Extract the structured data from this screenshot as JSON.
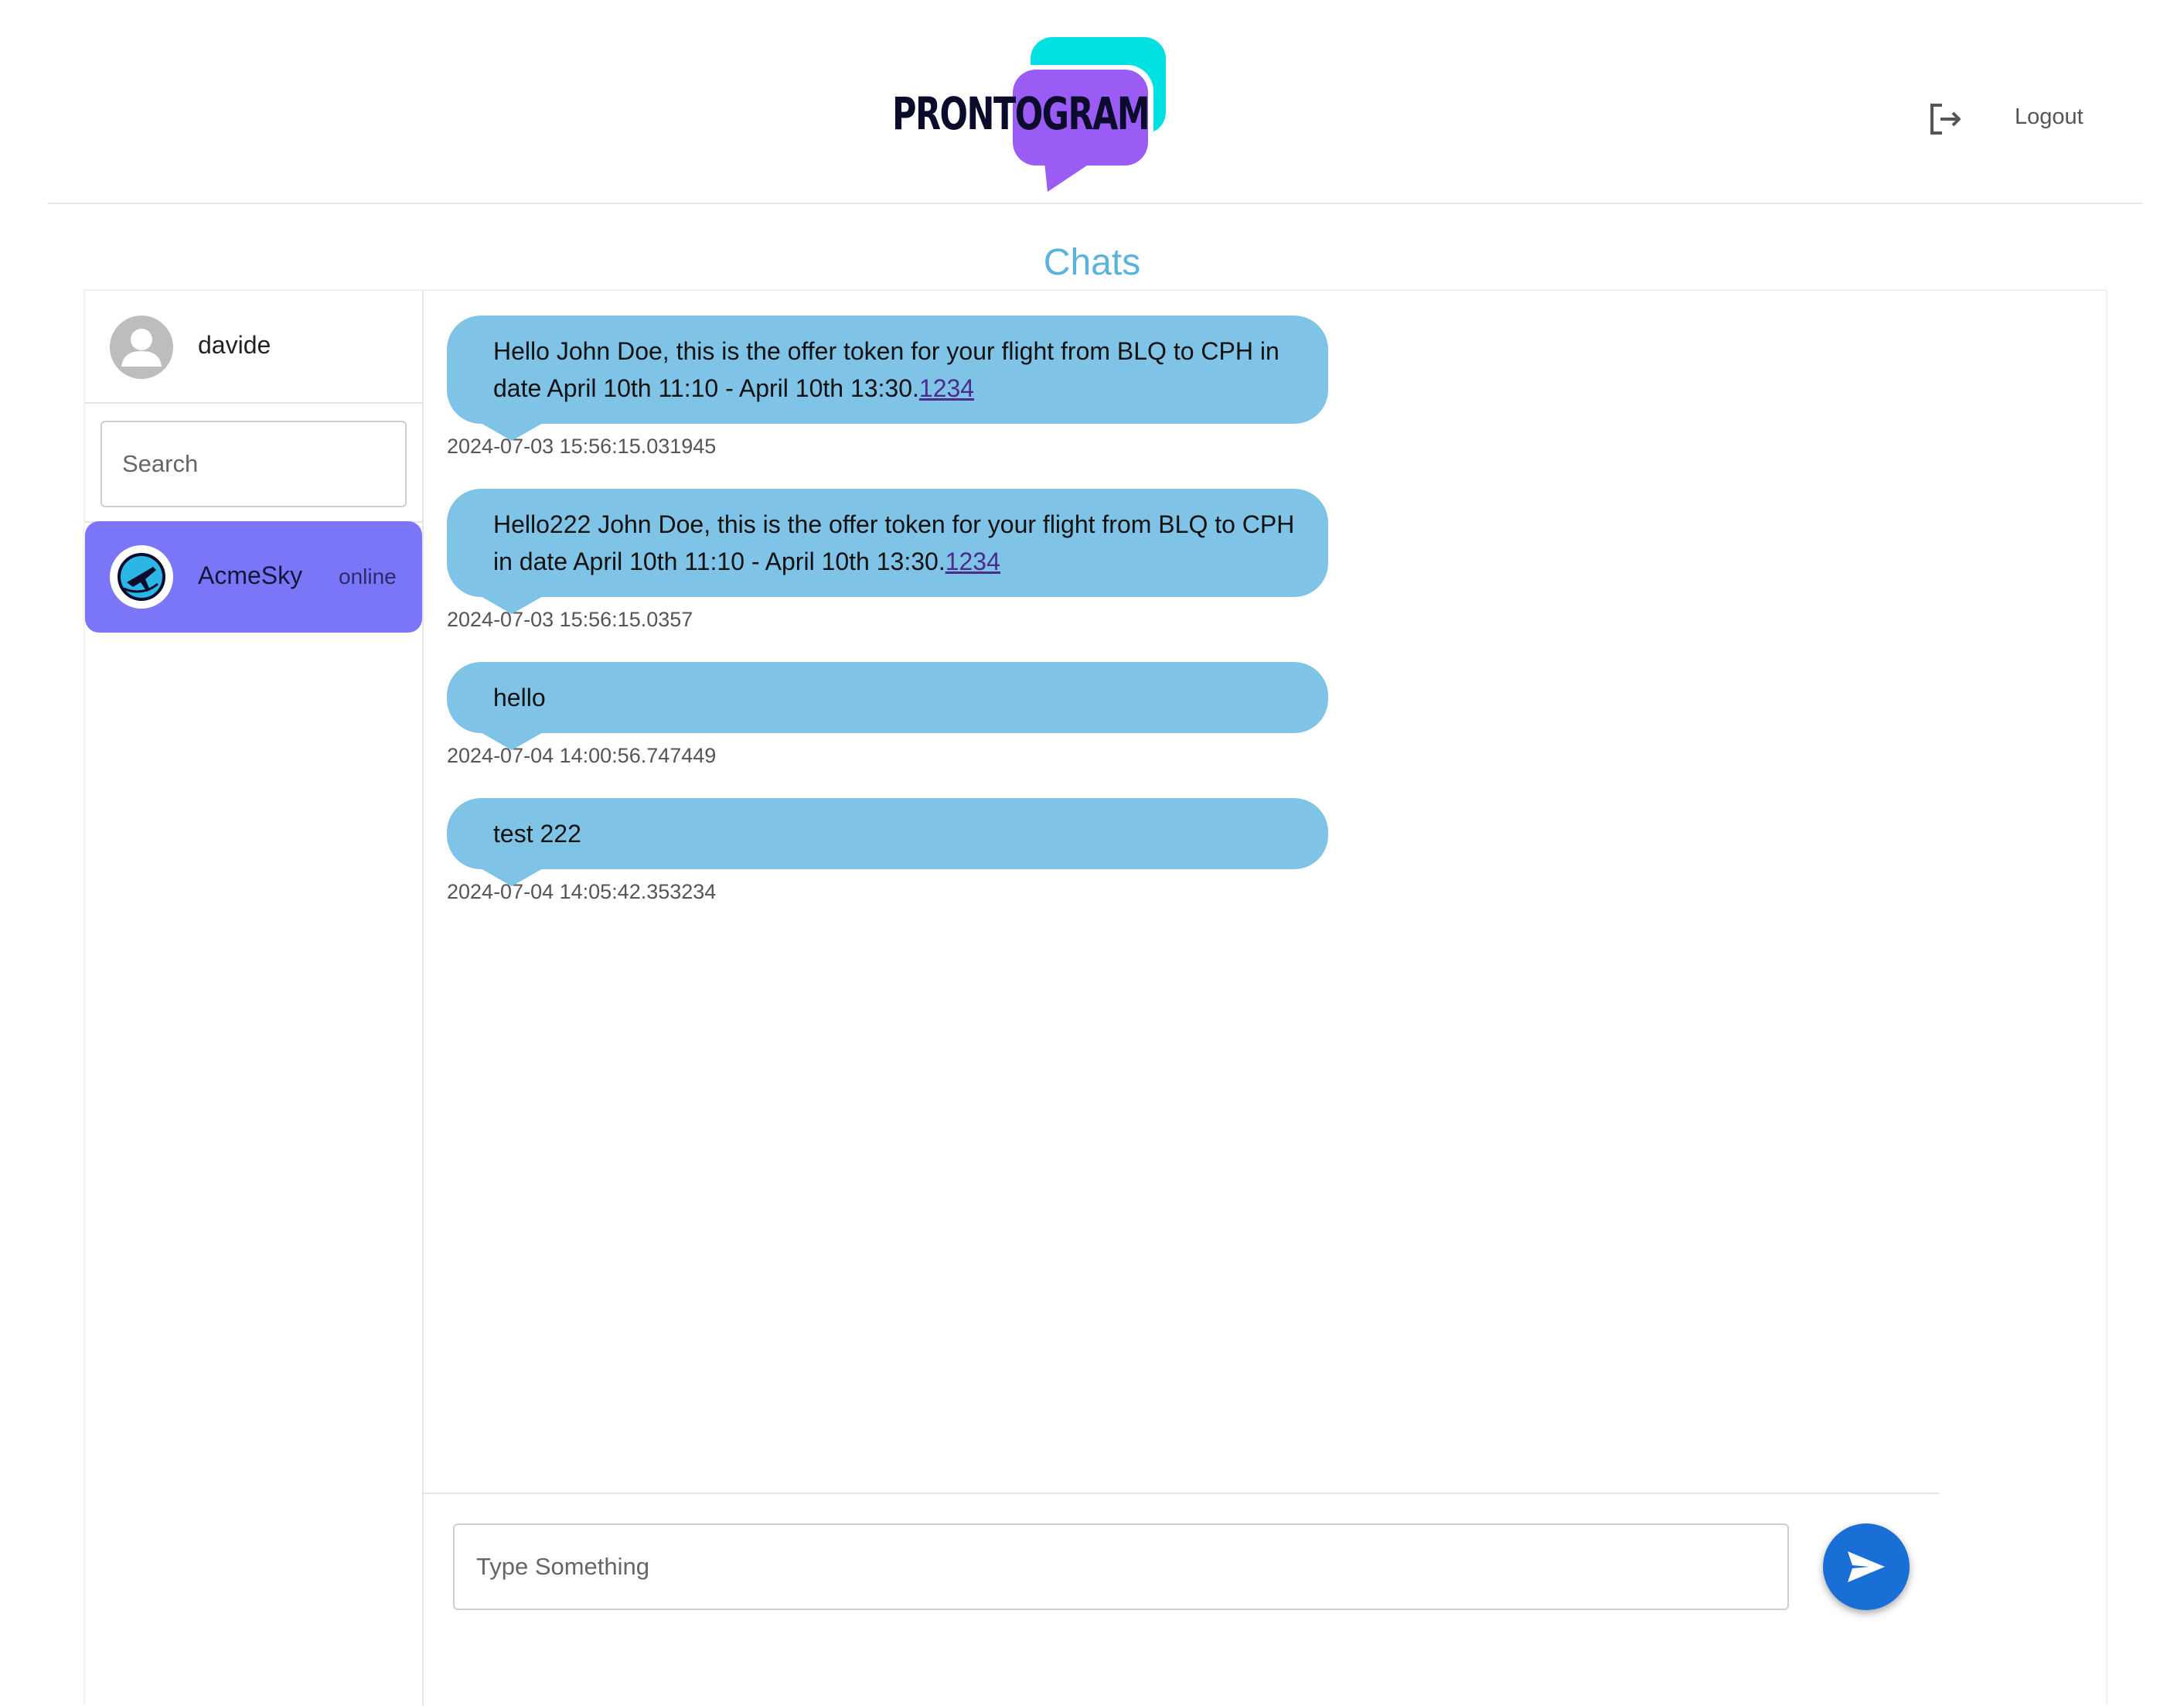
{
  "header": {
    "logo_text": "PRONTOGRAM",
    "logout_label": "Logout",
    "icons": {
      "logout": "logout-icon"
    }
  },
  "page_title": "Chats",
  "sidebar": {
    "user": {
      "name": "davide",
      "avatar_icon": "person-icon"
    },
    "search": {
      "placeholder": "Search",
      "value": ""
    },
    "contacts": [
      {
        "name": "AcmeSky",
        "status": "online",
        "avatar_icon": "plane-logo-icon",
        "selected": true
      }
    ]
  },
  "messages": [
    {
      "text": "Hello John Doe, this is the offer token for your flight from BLQ to CPH in date April 10th 11:10 - April 10th 13:30.",
      "link": "1234",
      "timestamp": "2024-07-03 15:56:15.031945"
    },
    {
      "text": "Hello222 John Doe, this is the offer token for your flight from BLQ to CPH in date April 10th 11:10 - April 10th 13:30.",
      "link": "1234",
      "timestamp": "2024-07-03 15:56:15.0357"
    },
    {
      "text": "hello",
      "link": "",
      "timestamp": "2024-07-04 14:00:56.747449"
    },
    {
      "text": "test 222",
      "link": "",
      "timestamp": "2024-07-04 14:05:42.353234"
    }
  ],
  "composer": {
    "placeholder": "Type Something",
    "value": "",
    "send_icon": "send-icon"
  },
  "colors": {
    "bubble": "#7fc3e6",
    "selected_contact": "#7b76f8",
    "title": "#5ab3dc",
    "send_button": "#1a6fd6",
    "logo_cyan": "#00e0e0",
    "logo_purple": "#9b5cf6"
  }
}
